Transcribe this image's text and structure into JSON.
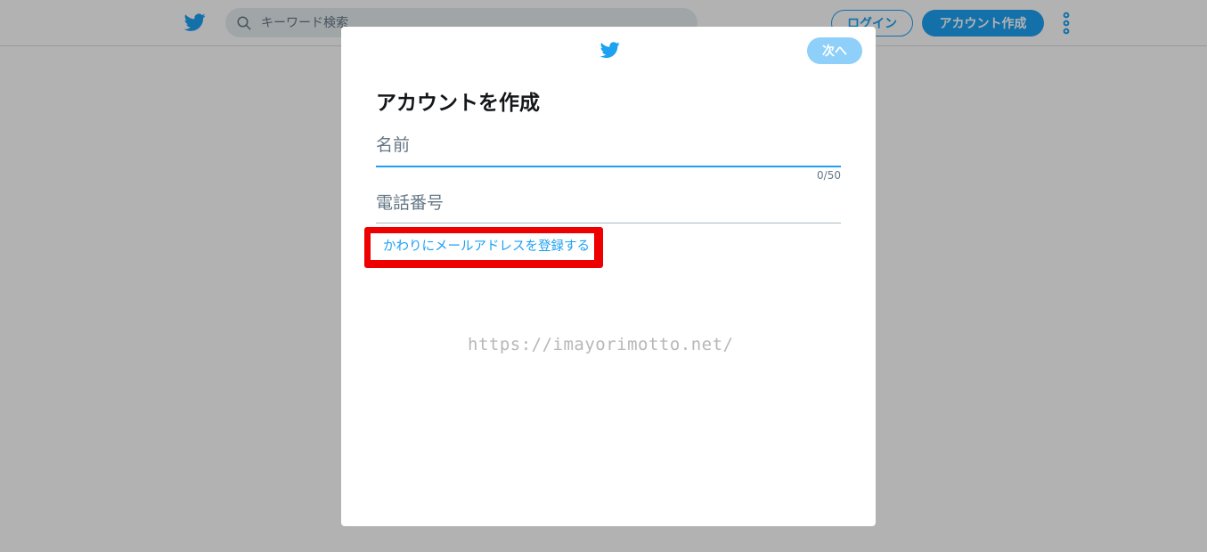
{
  "colors": {
    "brand_blue": "#1da1f2",
    "next_disabled": "#8ed0f9",
    "highlight_red": "#ee0000",
    "text_primary": "#14171a",
    "text_secondary": "#657786"
  },
  "header": {
    "logo_icon": "twitter-bird-icon",
    "search": {
      "icon": "search-icon",
      "placeholder": "キーワード検索",
      "value": ""
    },
    "login_label": "ログイン",
    "signup_label": "アカウント作成",
    "more_icon": "vertical-dots-icon"
  },
  "modal": {
    "logo_icon": "twitter-bird-icon",
    "next_label": "次へ",
    "title": "アカウントを作成",
    "name_field": {
      "placeholder": "名前",
      "value": "",
      "counter": "0/50"
    },
    "phone_field": {
      "placeholder": "電話番号",
      "value": ""
    },
    "email_link": "かわりにメールアドレスを登録する",
    "watermark": "https://imayorimotto.net/"
  }
}
